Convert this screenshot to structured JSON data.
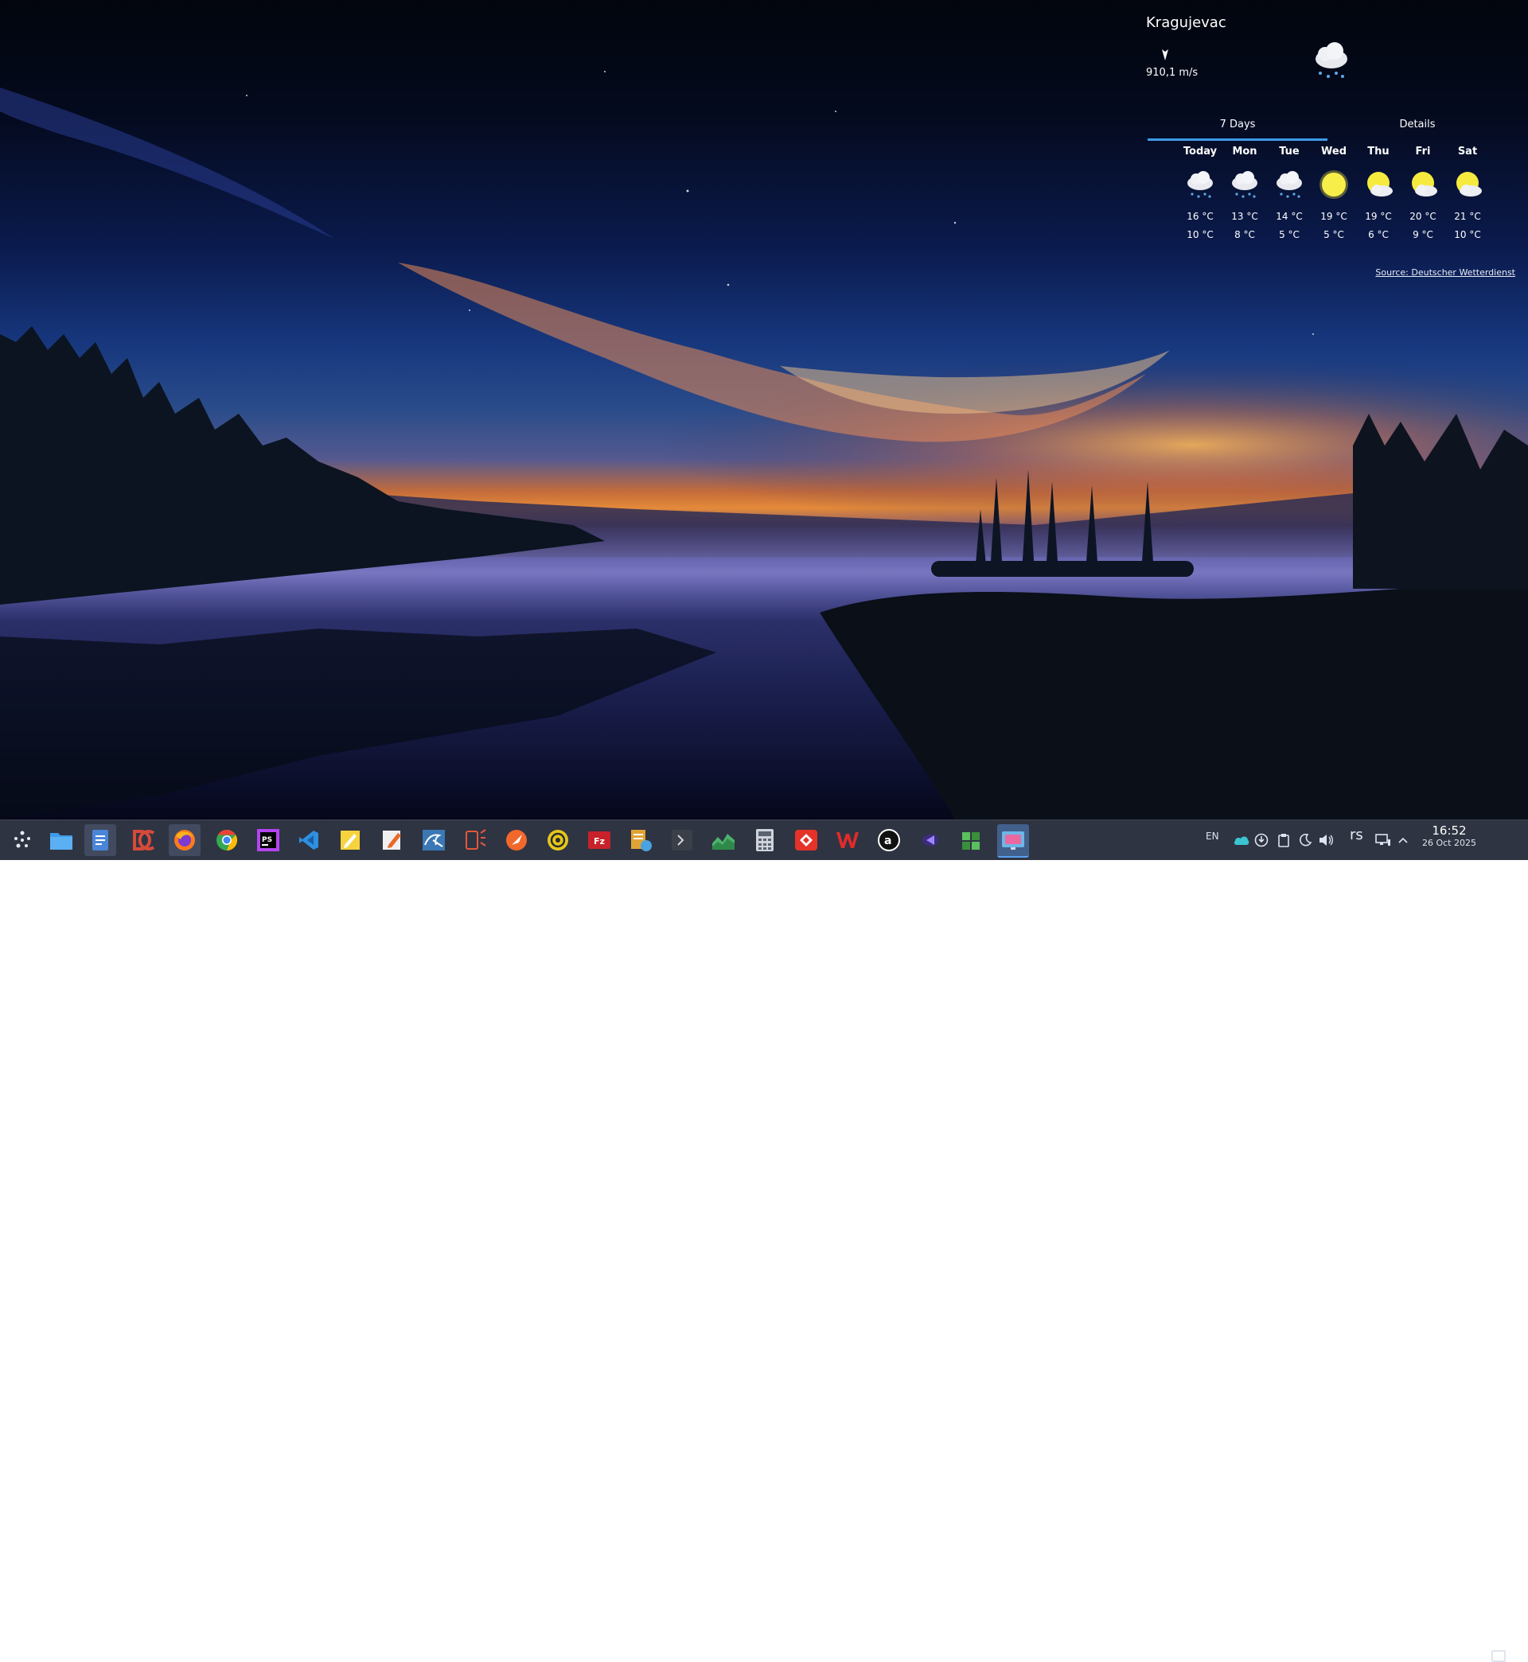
{
  "weather": {
    "location": "Kragujevac",
    "wind_speed": "910,1 m/s",
    "tabs": [
      "7 Days",
      "Details"
    ],
    "days": [
      {
        "name": "Today",
        "high": "16 °C",
        "low": "10 °C",
        "icon": "rain-cloud-icon"
      },
      {
        "name": "Mon",
        "high": "13 °C",
        "low": "8 °C",
        "icon": "rain-cloud-icon"
      },
      {
        "name": "Tue",
        "high": "14 °C",
        "low": "5 °C",
        "icon": "rain-cloud-icon"
      },
      {
        "name": "Wed",
        "high": "19 °C",
        "low": "5 °C",
        "icon": "sun-icon"
      },
      {
        "name": "Thu",
        "high": "19 °C",
        "low": "6 °C",
        "icon": "partly-cloudy-icon"
      },
      {
        "name": "Fri",
        "high": "20 °C",
        "low": "9 °C",
        "icon": "partly-cloudy-icon"
      },
      {
        "name": "Sat",
        "high": "21 °C",
        "low": "10 °C",
        "icon": "partly-cloudy-icon"
      }
    ],
    "source": "Source: Deutscher Wetterdienst"
  },
  "taskbar": {
    "apps": [
      {
        "name": "app-launcher",
        "color": "#e6ebf5"
      },
      {
        "name": "file-manager",
        "color": "#3f9ae8"
      },
      {
        "name": "text-document",
        "color": "#4a86d8"
      },
      {
        "name": "doublecmd",
        "color": "#d64a3a"
      },
      {
        "name": "firefox",
        "color": "#ff7a1a"
      },
      {
        "name": "chrome",
        "color": "#34a853"
      },
      {
        "name": "phpstorm",
        "color": "#b345f1"
      },
      {
        "name": "vscode",
        "color": "#2f8fe0"
      },
      {
        "name": "notes",
        "color": "#f6d33c"
      },
      {
        "name": "text-editor",
        "color": "#f0f0f0"
      },
      {
        "name": "mysql-workbench",
        "color": "#3a78b5"
      },
      {
        "name": "devtools",
        "color": "#e4573c"
      },
      {
        "name": "compass",
        "color": "#f2682c"
      },
      {
        "name": "settings-gear",
        "color": "#e6c61c"
      },
      {
        "name": "filezilla",
        "color": "#c8212a"
      },
      {
        "name": "web-server",
        "color": "#e0a336"
      },
      {
        "name": "terminal",
        "color": "#3a3f48"
      },
      {
        "name": "system-monitor",
        "color": "#49b36b"
      },
      {
        "name": "calculator",
        "color": "#cfd3da"
      },
      {
        "name": "anydesk",
        "color": "#e5332a"
      },
      {
        "name": "wps-office",
        "color": "#e02b2b"
      },
      {
        "name": "amazon",
        "color": "#111111"
      },
      {
        "name": "qt-creator",
        "color": "#6f5bd8"
      },
      {
        "name": "package-manager",
        "color": "#5bbf5e"
      },
      {
        "name": "screenshot-tool",
        "color": "#6bb7e8"
      }
    ],
    "language": "EN",
    "keyboard_layout": "rs",
    "time": "16:52",
    "date": "26 Oct 2025"
  }
}
